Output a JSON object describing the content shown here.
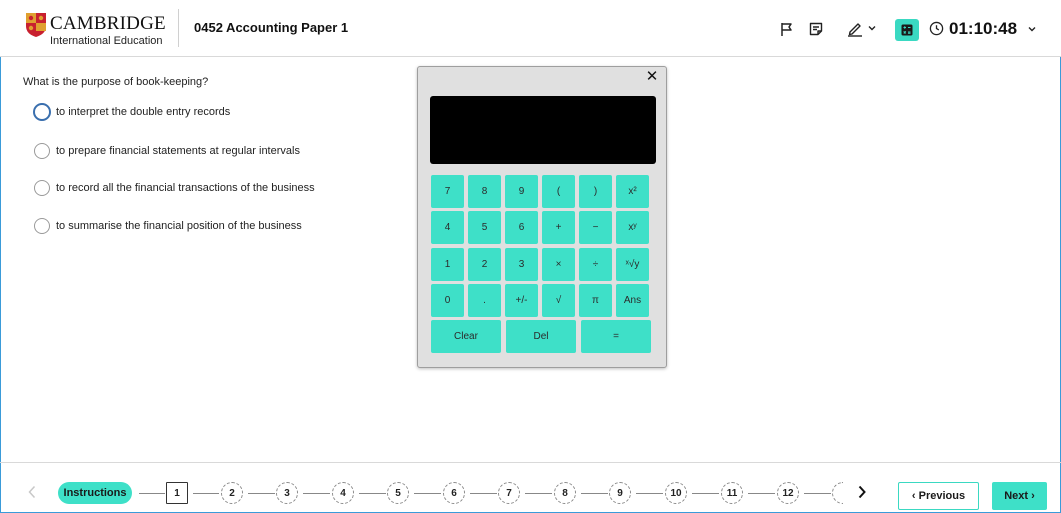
{
  "header": {
    "logo_name": "CAMBRIDGE",
    "logo_sub": "International Education",
    "paper_title": "0452 Accounting Paper 1",
    "timer": "01:10:48",
    "icons": [
      "flag-icon",
      "notes-icon",
      "pen-icon",
      "calculator-icon",
      "clock-icon"
    ]
  },
  "question": {
    "text": "What is the purpose of book-keeping?",
    "options": [
      "to interpret the double entry records",
      "to prepare financial statements at regular intervals",
      "to record all the financial transactions of the business",
      "to summarise the financial position of the business"
    ]
  },
  "calculator": {
    "close": "✕",
    "keys": {
      "seven": "7",
      "eight": "8",
      "nine": "9",
      "lparen": "(",
      "rparen": ")",
      "square": "x²",
      "four": "4",
      "five": "5",
      "six": "6",
      "plus": "+",
      "minus": "−",
      "power": "xʸ",
      "one": "1",
      "two": "2",
      "three": "3",
      "times": "×",
      "divide": "÷",
      "root": "ˣ√y",
      "zero": "0",
      "dot": ".",
      "sign": "+/-",
      "sqrt": "√",
      "pi": "π",
      "ans": "Ans",
      "clear": "Clear",
      "del": "Del",
      "equals": "="
    }
  },
  "footer": {
    "instructions": "Instructions",
    "questions": [
      "1",
      "2",
      "3",
      "4",
      "5",
      "6",
      "7",
      "8",
      "9",
      "10",
      "11",
      "12"
    ],
    "current_question": "1",
    "previous": "‹ Previous",
    "next": "Next ›"
  },
  "colors": {
    "accent": "#3ee0c8",
    "display": "#000000",
    "calculator_body": "#e0e0e0"
  }
}
